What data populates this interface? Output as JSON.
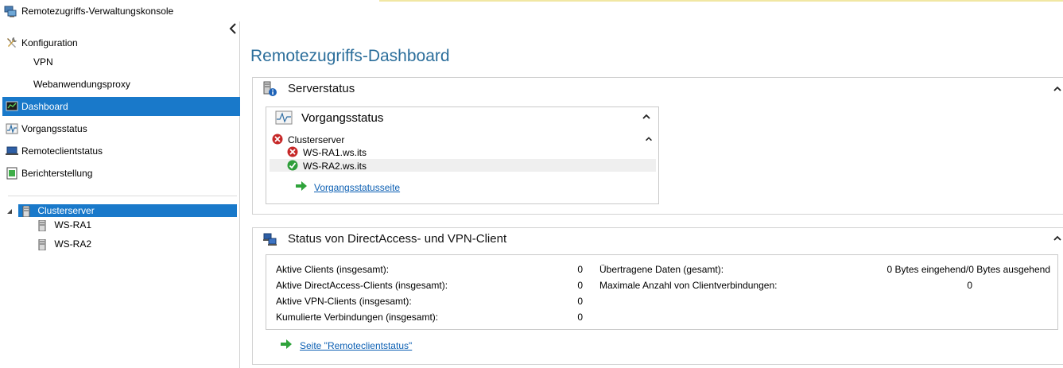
{
  "window": {
    "title": "Remotezugriffs-Verwaltungskonsole"
  },
  "sidebar": {
    "configuration_label": "Konfiguration",
    "vpn_label": "VPN",
    "webproxy_label": "Webanwendungsproxy",
    "dashboard_label": "Dashboard",
    "operations_label": "Vorgangsstatus",
    "remoteclient_label": "Remoteclientstatus",
    "reporting_label": "Berichterstellung",
    "tree": {
      "root_label": "Clusterserver",
      "children": [
        "WS-RA1",
        "WS-RA2"
      ]
    }
  },
  "main": {
    "title": "Remotezugriffs-Dashboard",
    "server_status": {
      "title": "Serverstatus",
      "operations": {
        "title": "Vorgangsstatus",
        "cluster_label": "Clusterserver",
        "servers": [
          {
            "name": "WS-RA1.ws.its",
            "status": "error"
          },
          {
            "name": "WS-RA2.ws.its",
            "status": "ok"
          }
        ],
        "link_label": "Vorgangsstatusseite"
      }
    },
    "client_status": {
      "title": "Status von DirectAccess- und VPN-Client",
      "left_stats": [
        {
          "label": "Aktive Clients (insgesamt):",
          "value": "0"
        },
        {
          "label": "Aktive DirectAccess-Clients (insgesamt):",
          "value": "0"
        },
        {
          "label": "Aktive VPN-Clients (insgesamt):",
          "value": "0"
        },
        {
          "label": "Kumulierte Verbindungen (insgesamt):",
          "value": "0"
        }
      ],
      "right_stats": [
        {
          "label": "Übertragene Daten (gesamt):",
          "value": "0 Bytes eingehend/0 Bytes ausgehend"
        },
        {
          "label": "Maximale Anzahl von Clientverbindungen:",
          "value": "0"
        }
      ],
      "link_label": "Seite \"Remoteclientstatus\""
    }
  },
  "colors": {
    "selection": "#1979ca",
    "title_blue": "#2b6e9b",
    "link": "#0b5fb3",
    "error": "#c62828",
    "ok": "#2e9e3a"
  }
}
